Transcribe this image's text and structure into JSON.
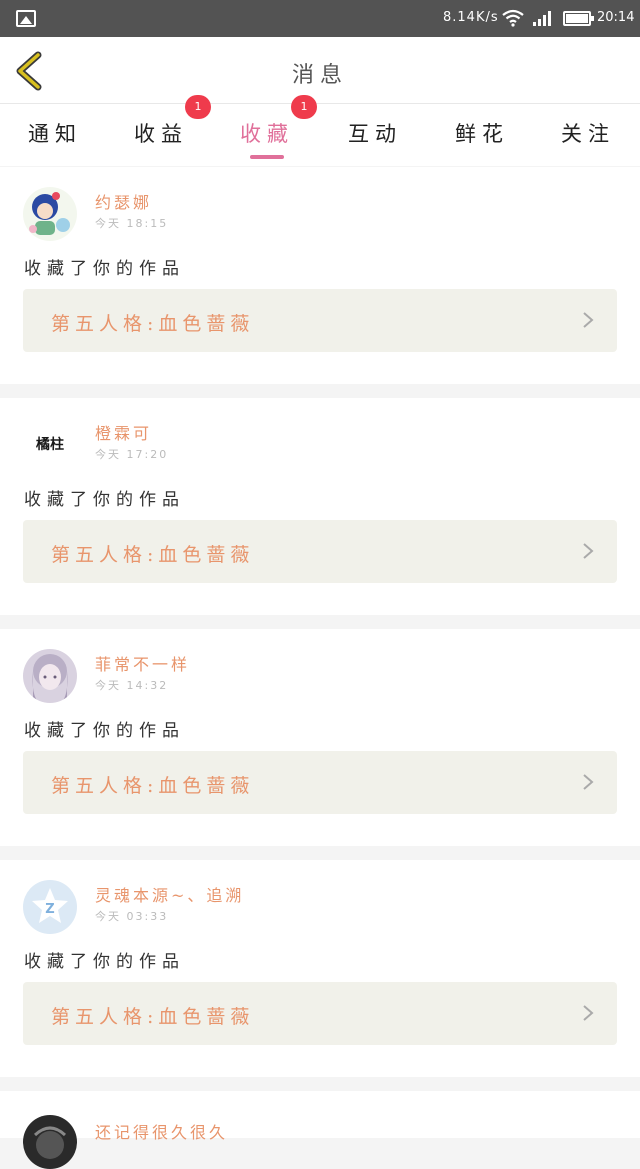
{
  "status_bar": {
    "speed": "8.14K/s",
    "time": "20:14"
  },
  "header": {
    "title": "消息"
  },
  "tabs": [
    {
      "label": "通知"
    },
    {
      "label": "收益",
      "badge": "1"
    },
    {
      "label": "收藏",
      "badge": "1",
      "active": true
    },
    {
      "label": "互动"
    },
    {
      "label": "鲜花"
    },
    {
      "label": "关注"
    }
  ],
  "colors": {
    "accent": "#e0709a",
    "name": "#e8956c",
    "badge": "#ef3b4c",
    "back_arrow": "#d8c020"
  },
  "messages": [
    {
      "name": "约瑟娜",
      "time": "今天 18:15",
      "action": "收藏了你的作品",
      "work": "第五人格:血色蔷薇"
    },
    {
      "name": "橙霖可",
      "time": "今天 17:20",
      "action": "收藏了你的作品",
      "work": "第五人格:血色蔷薇",
      "avatar_text": "橘柱"
    },
    {
      "name": "菲常不一样",
      "time": "今天 14:32",
      "action": "收藏了你的作品",
      "work": "第五人格:血色蔷薇"
    },
    {
      "name": "灵魂本源~、追溯",
      "time": "今天 03:33",
      "action": "收藏了你的作品",
      "work": "第五人格:血色蔷薇"
    },
    {
      "name": "还记得很久很久"
    }
  ]
}
